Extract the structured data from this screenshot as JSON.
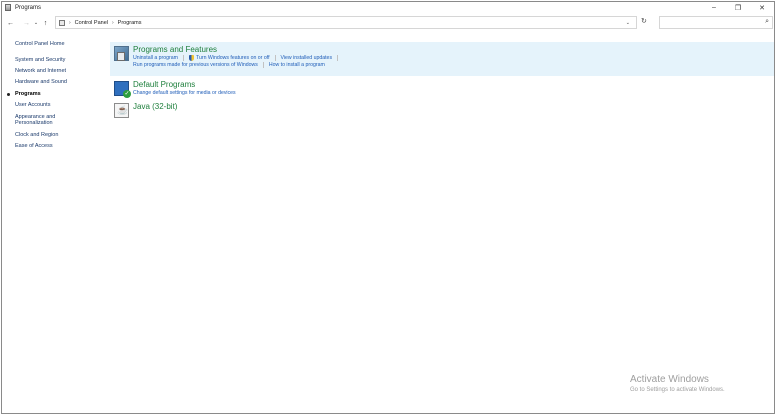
{
  "window": {
    "title": "Programs"
  },
  "titlebar": {
    "minimize": "–",
    "maximize": "❐",
    "close": "✕"
  },
  "nav": {
    "back": "←",
    "forward": "→",
    "recent": "⌄",
    "up": "↑",
    "refresh": "↻",
    "dropdown": "⌄"
  },
  "address": {
    "breadcrumbs": [
      "Control Panel",
      "Programs"
    ],
    "separator": "›"
  },
  "search": {
    "placeholder": "",
    "icon": "⌕"
  },
  "sidebar": {
    "home": "Control Panel Home",
    "items": [
      {
        "label": "System and Security"
      },
      {
        "label": "Network and Internet"
      },
      {
        "label": "Hardware and Sound"
      },
      {
        "label": "Programs",
        "active": true
      },
      {
        "label": "User Accounts"
      },
      {
        "label": "Appearance and Personalization"
      },
      {
        "label": "Clock and Region"
      },
      {
        "label": "Ease of Access"
      }
    ]
  },
  "categories": {
    "programs_features": {
      "title": "Programs and Features",
      "links": [
        "Uninstall a program",
        "Turn Windows features on or off",
        "View installed updates",
        "Run programs made for previous versions of Windows",
        "How to install a program"
      ]
    },
    "default_programs": {
      "title": "Default Programs",
      "links": [
        "Change default settings for media or devices"
      ]
    },
    "java": {
      "title": "Java (32-bit)"
    }
  },
  "watermark": {
    "title": "Activate Windows",
    "subtitle": "Go to Settings to activate Windows."
  }
}
